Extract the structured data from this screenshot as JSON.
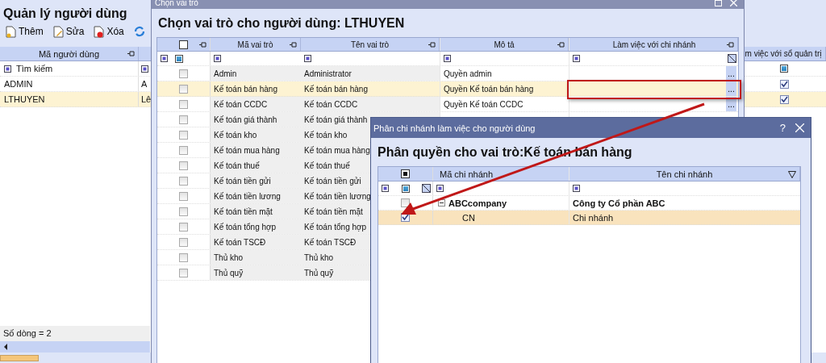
{
  "main": {
    "title": "Quản lý người dùng",
    "toolbar": [
      {
        "label": "Thêm",
        "kind": "add"
      },
      {
        "label": "Sửa",
        "kind": "edit"
      },
      {
        "label": "Xóa",
        "kind": "delete"
      },
      {
        "kind": "refresh"
      }
    ],
    "columns": {
      "code": "Mã người dùng",
      "admin_book": "m việc với sổ quản trị"
    },
    "filter_placeholder": "Tìm kiếm",
    "rows": [
      {
        "code": "ADMIN",
        "column_2": "A",
        "admin_book": true,
        "selected": false
      },
      {
        "code": "LTHUYEN",
        "column_2": "Lê",
        "admin_book": true,
        "selected": true
      }
    ],
    "footer": "Số dòng = 2"
  },
  "role_dialog": {
    "title": "Chọn vai trò",
    "heading": "Chọn vai trò cho người dùng: LTHUYEN",
    "header_checked": false,
    "columns": {
      "code": "Mã vai trò",
      "name": "Tên vai trò",
      "description": "Mô tả",
      "branch": "Làm việc với chi nhánh"
    },
    "rows": [
      {
        "code": "Admin",
        "name": "Administrator",
        "description": "Quyền admin",
        "branch_button": "...",
        "checked": false,
        "selected": false
      },
      {
        "code": "Kế toán bán hàng",
        "name": "Kế toán bán hàng",
        "description": "Quyền Kế toán bán hàng",
        "branch_button": "...",
        "checked": false,
        "selected": true
      },
      {
        "code": "Kế toán CCDC",
        "name": "Kế toán CCDC",
        "description": "Quyền Kế toán CCDC",
        "branch_button": "...",
        "checked": false,
        "selected": false
      },
      {
        "code": "Kế toán giá thành",
        "name": "Kế toán giá thành",
        "checked": false,
        "selected": false
      },
      {
        "code": "Kế toán kho",
        "name": "Kế toán kho",
        "checked": false,
        "selected": false
      },
      {
        "code": "Kế toán mua hàng",
        "name": "Kế toán mua hàng",
        "checked": false,
        "selected": false
      },
      {
        "code": "Kế toán thuế",
        "name": "Kế toán thuế",
        "checked": false,
        "selected": false
      },
      {
        "code": "Kế toán tiền gửi",
        "name": "Kế toán tiền gửi",
        "checked": false,
        "selected": false
      },
      {
        "code": "Kế toán tiền lương",
        "name": "Kế toán tiền lương",
        "checked": false,
        "selected": false
      },
      {
        "code": "Kế toán tiền mặt",
        "name": "Kế toán tiền mặt",
        "checked": false,
        "selected": false
      },
      {
        "code": "Kế toán tổng hợp",
        "name": "Kế toán tổng hợp",
        "checked": false,
        "selected": false
      },
      {
        "code": "Kế toán TSCĐ",
        "name": "Kế toán TSCĐ",
        "checked": false,
        "selected": false
      },
      {
        "code": "Thủ kho",
        "name": "Thủ kho",
        "checked": false,
        "selected": false
      },
      {
        "code": "Thủ quỹ",
        "name": "Thủ quỹ",
        "checked": false,
        "selected": false
      }
    ]
  },
  "branch_dialog": {
    "title": "Phân chi nhánh làm việc cho người dùng",
    "help": "?",
    "heading": "Phân quyền cho vai trò:Kế toán bán hàng",
    "header_partial": true,
    "columns": {
      "code": "Mã chi nhánh",
      "name": "Tên chi nhánh"
    },
    "rows": [
      {
        "code": "ABCcompany",
        "name": "Công ty Cổ phần ABC",
        "checked": false,
        "selected": false,
        "expanded": true,
        "children": [
          {
            "code": "CN",
            "name": "Chi nhánh",
            "checked": true,
            "selected": true
          }
        ]
      }
    ]
  }
}
